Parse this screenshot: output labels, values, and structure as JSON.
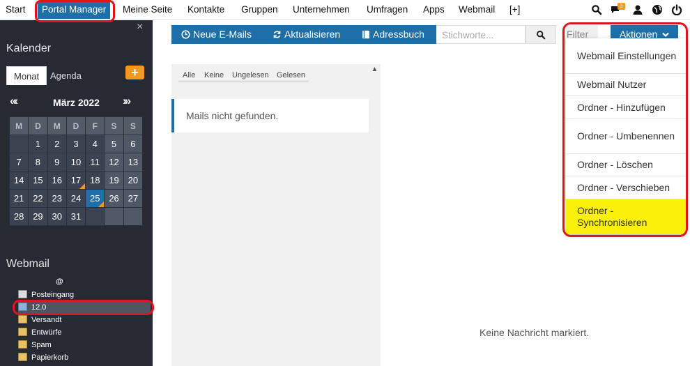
{
  "topnav": {
    "items": [
      "Start",
      "Portal Manager",
      "Meine Seite",
      "Kontakte",
      "Gruppen",
      "Unternehmen",
      "Umfragen",
      "Apps",
      "Webmail",
      "[+]"
    ],
    "chat_badge": "3"
  },
  "sidebar": {
    "close": "×",
    "calendar_heading": "Kalender",
    "tab_month": "Monat",
    "tab_agenda": "Agenda",
    "add_button": "+",
    "prev": "«‹",
    "next": "›»",
    "month_title": "März 2022",
    "weekdays": [
      "M",
      "D",
      "M",
      "D",
      "F",
      "S",
      "S"
    ],
    "weeks": [
      [
        "",
        "1",
        "2",
        "3",
        "4",
        "5",
        "6"
      ],
      [
        "7",
        "8",
        "9",
        "10",
        "11",
        "12",
        "13"
      ],
      [
        "14",
        "15",
        "16",
        "17",
        "18",
        "19",
        "20"
      ],
      [
        "21",
        "22",
        "23",
        "24",
        "25",
        "26",
        "27"
      ],
      [
        "28",
        "29",
        "30",
        "31",
        "",
        "",
        ""
      ]
    ],
    "webmail_heading": "Webmail",
    "account": "@",
    "folders": [
      "Posteingang",
      "12.0",
      "Versandt",
      "Entwürfe",
      "Spam",
      "Papierkorb"
    ]
  },
  "toolbar": {
    "new_mail": "Neue E-Mails",
    "refresh": "Aktualisieren",
    "addressbook": "Adressbuch",
    "search_placeholder": "Stichworte...",
    "filter": "Filter",
    "actions": "Aktionen"
  },
  "maillist": {
    "filters": [
      "Alle",
      "Keine",
      "Ungelesen",
      "Gelesen"
    ],
    "empty_message": "Mails nicht gefunden."
  },
  "preview": {
    "empty_message": "Keine Nachricht markiert."
  },
  "actions_menu": {
    "items": [
      "Webmail Einstellungen",
      "Webmail Nutzer",
      "Ordner - Hinzufügen",
      "Ordner - Umbenennen",
      "Ordner - Löschen",
      "Ordner - Verschieben",
      "Ordner - Synchronisieren"
    ],
    "highlighted": "Ordner - Synchronisieren"
  },
  "colors": {
    "accent_blue": "#1e6fa8",
    "sidebar_bg": "#262b33",
    "orange": "#f39a1e",
    "highlight_yellow": "#fbf108",
    "annotation_red": "#e0141e"
  }
}
